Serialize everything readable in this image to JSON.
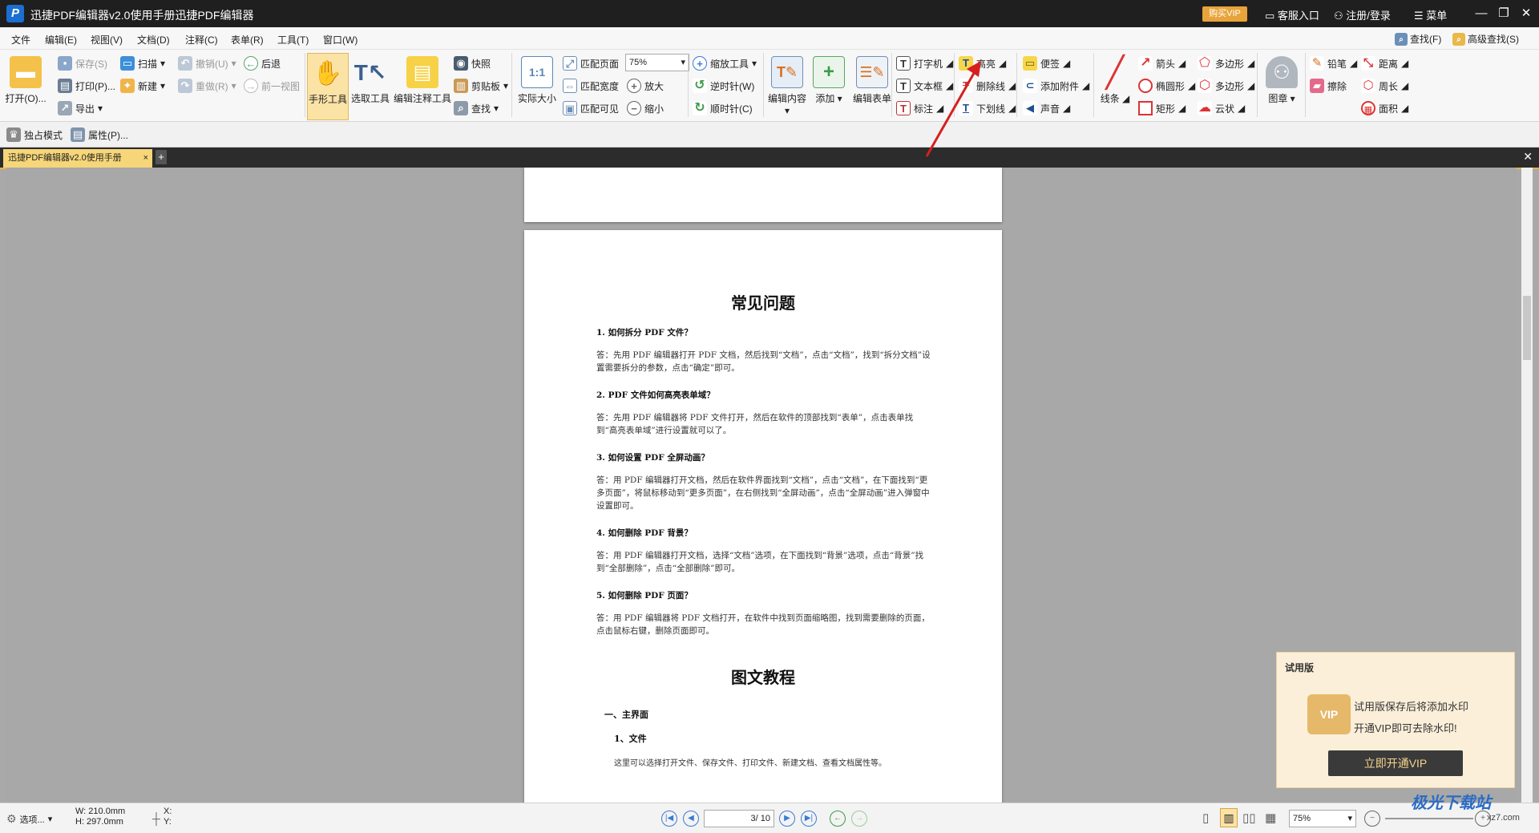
{
  "titlebar": {
    "app_icon_letter": "P",
    "title": "迅捷PDF编辑器v2.0使用手册迅捷PDF编辑器",
    "buy_vip": "购买VIP",
    "service": "客服入口",
    "login": "注册/登录",
    "menu": "菜单",
    "minimize": "—",
    "maximize": "❐",
    "close": "✕"
  },
  "menubar": {
    "items": [
      "文件",
      "编辑(E)",
      "视图(V)",
      "文档(D)",
      "注释(C)",
      "表单(R)",
      "工具(T)",
      "窗口(W)"
    ],
    "find": "查找(F)",
    "advanced_find": "高级查找(S)"
  },
  "ribbon": {
    "open": "打开(O)...",
    "save": "保存(S)",
    "print": "打印(P)...",
    "export": "导出",
    "scan": "扫描",
    "new": "新建",
    "undo": "撤销(U)",
    "redo": "重做(R)",
    "back": "后退",
    "prev_view": "前一视图",
    "hand_tool": "手形工具",
    "select_tool": "选取工具",
    "edit_annot_tool": "编辑注释工具",
    "snapshot": "快照",
    "clipboard": "剪贴板",
    "search": "查找",
    "actual_size": "实际大小",
    "fit_page": "匹配页面",
    "fit_width": "匹配宽度",
    "fit_visible": "匹配可见",
    "zoom_value": "75%",
    "zoom_tool": "缩放工具",
    "zoom_in": "放大",
    "zoom_out": "缩小",
    "rotate_ccw": "逆时针(W)",
    "rotate_cw": "顺时针(C)",
    "edit_content": "编辑内容",
    "add": "添加",
    "edit_form": "编辑表单",
    "typewriter": "打字机",
    "textbox": "文本框",
    "callout": "标注",
    "highlight": "高亮",
    "strikeout": "删除线",
    "underline": "下划线",
    "note": "便签",
    "attach": "添加附件",
    "sound": "声音",
    "line": "线条",
    "arrow": "箭头",
    "ellipse": "椭圆形",
    "rect": "矩形",
    "polygon": "多边形",
    "polyline": "多边形",
    "cloud": "云状",
    "stamp": "图章",
    "pencil": "铅笔",
    "eraser": "擦除",
    "distance": "距离",
    "perimeter": "周长",
    "area": "面积",
    "exclusive_mode": "独占模式",
    "properties": "属性(P)..."
  },
  "tabs": {
    "doc_tab": "迅捷PDF编辑器v2.0使用手册",
    "close": "×",
    "add": "+",
    "close_all": "✕"
  },
  "page": {
    "faq_title": "常见问题",
    "q1": "1.  如何拆分 PDF 文件？",
    "a1": "答：先用 PDF 编辑器打开 PDF 文档，然后找到“文档”，点击“文档”，找到“拆分文档”设置需要拆分的参数，点击“确定”即可。",
    "q2": "2.  PDF 文件如何高亮表单域？",
    "a2": "答：先用 PDF 编辑器将 PDF 文件打开，然后在软件的顶部找到“表单”，点击表单找到“高亮表单域”进行设置就可以了。",
    "q3": "3.  如何设置 PDF 全屏动画？",
    "a3": "答：用 PDF 编辑器打开文档，然后在软件界面找到“文档”，点击“文档”，在下面找到“更多页面”，将鼠标移动到“更多页面”，在右侧找到“全屏动画”，点击“全屏动画”进入弹窗中设置即可。",
    "q4": "4.  如何删除 PDF 背景？",
    "a4": "答：用 PDF 编辑器打开文档，选择“文档”选项，在下面找到“背景”选项，点击“背景”找到“全部删除”，点击“全部删除”即可。",
    "q5": "5.  如何删除 PDF 页面？",
    "a5": "答：用 PDF 编辑器将 PDF 文档打开，在软件中找到页面缩略图，找到需要删除的页面，点击鼠标右键，删除页面即可。",
    "tutorial_title": "图文教程",
    "section1": "一、主界面",
    "section1_1": "1、文件",
    "section1_1_text": "这里可以选择打开文件、保存文件、打印文件、新建文档、查看文档属性等。"
  },
  "popup": {
    "title": "试用版",
    "crown": "VIP",
    "line1": "试用版保存后将添加水印",
    "line2": "开通VIP即可去除水印!",
    "cta": "立即开通VIP"
  },
  "status": {
    "options": "选项...",
    "width": "W: 210.0mm",
    "height": "H: 297.0mm",
    "x": "X:",
    "y": "Y:",
    "page": "3",
    "page_total": "/ 10",
    "zoom": "75%"
  },
  "watermark": {
    "brand": "极光下载站",
    "url": "xz7.com"
  }
}
